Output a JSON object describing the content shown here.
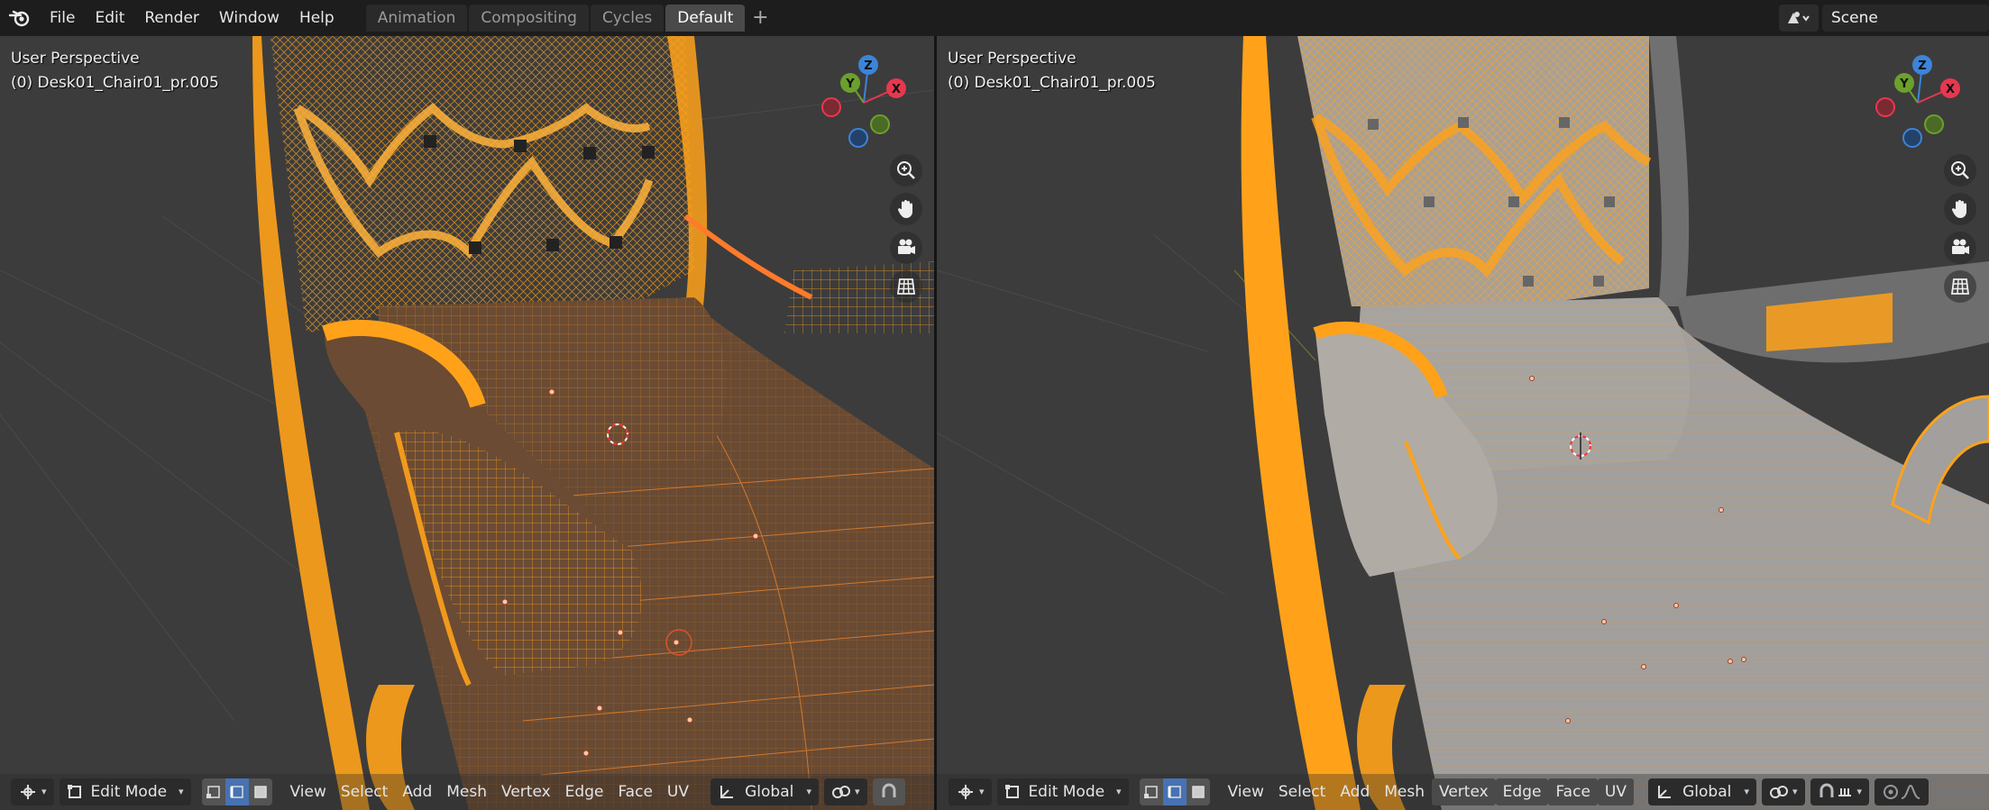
{
  "menu": {
    "logo_icon": "blender-logo-icon",
    "items": [
      "File",
      "Edit",
      "Render",
      "Window",
      "Help"
    ]
  },
  "workspaces": {
    "tabs": [
      "Animation",
      "Compositing",
      "Cycles",
      "Default"
    ],
    "active": "Default",
    "add_label": "+"
  },
  "scene": {
    "icon": "scene-icon",
    "name": "Scene"
  },
  "viewports": [
    {
      "view_name": "User Perspective",
      "object_name": "(0) Desk01_Chair01_pr.005",
      "shading": "wireframe",
      "gizmo": {
        "z": "Z",
        "y": "Y",
        "x": "X"
      },
      "nav_icons": [
        "zoom-icon",
        "hand-pan-icon",
        "camera-icon",
        "grid-toggle-icon"
      ],
      "header": {
        "mode": "Edit Mode",
        "menus": [
          "View",
          "Select",
          "Add",
          "Mesh",
          "Vertex",
          "Edge",
          "Face",
          "UV"
        ],
        "transform_orientation": "Global"
      }
    },
    {
      "view_name": "User Perspective",
      "object_name": "(0) Desk01_Chair01_pr.005",
      "shading": "solid",
      "gizmo": {
        "z": "Z",
        "y": "Y",
        "x": "X"
      },
      "nav_icons": [
        "zoom-icon",
        "hand-pan-icon",
        "camera-icon",
        "grid-toggle-icon"
      ],
      "header": {
        "mode": "Edit Mode",
        "menus": [
          "View",
          "Select",
          "Add",
          "Mesh",
          "Vertex",
          "Edge",
          "Face",
          "UV"
        ],
        "highlighted_menus": [
          "Vertex",
          "Edge",
          "Face",
          "UV"
        ],
        "transform_orientation": "Global"
      }
    }
  ],
  "colors": {
    "selection_orange": "#ffa21a",
    "axis_x": "#e8374e",
    "axis_y": "#6ca02c",
    "axis_z": "#3c84d8",
    "active_toggle": "#4772b3"
  }
}
